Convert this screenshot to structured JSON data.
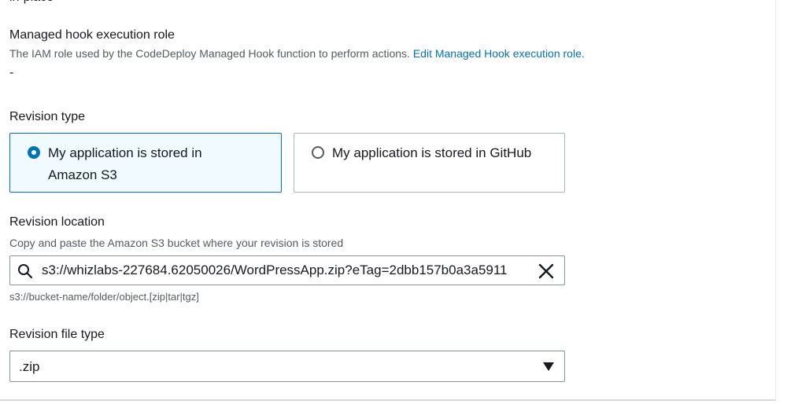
{
  "previous_section": {
    "cut_text": "in-place"
  },
  "managed_hook": {
    "label": "Managed hook execution role",
    "description": "The IAM role used by the CodeDeploy Managed Hook function to perform actions.",
    "link_text": "Edit Managed Hook execution role.",
    "value": "-"
  },
  "revision_type": {
    "label": "Revision type",
    "options": [
      {
        "label": "My application is stored in Amazon S3",
        "selected": true
      },
      {
        "label": "My application is stored in GitHub",
        "selected": false
      }
    ]
  },
  "revision_location": {
    "label": "Revision location",
    "description": "Copy and paste the Amazon S3 bucket where your revision is stored",
    "value": "s3://whizlabs-227684.62050026/WordPressApp.zip?eTag=2dbb157b0a3a5911",
    "hint": "s3://bucket-name/folder/object.[zip|tar|tgz]",
    "search_icon": "search-icon",
    "clear_icon": "close-icon"
  },
  "revision_file_type": {
    "label": "Revision file type",
    "value": ".zip",
    "caret_icon": "caret-down-icon"
  },
  "colors": {
    "accent": "#0073bb",
    "selected_bg": "#f1faff",
    "border": "#879596",
    "muted_text": "#545b64"
  }
}
